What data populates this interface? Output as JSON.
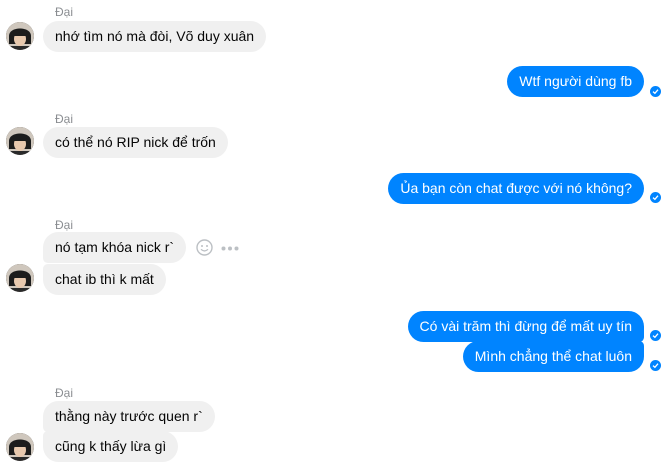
{
  "colors": {
    "outgoing_bubble": "#0084ff",
    "incoming_bubble": "#f0f0f0",
    "sender_name": "#8a8d91",
    "incoming_text": "#050505"
  },
  "messages": [
    {
      "sender": "Đại",
      "text": "nhớ tìm nó mà đòi, Võ duy xuân"
    },
    {
      "text": "Wtf người dùng fb"
    },
    {
      "sender": "Đại",
      "text": "có thể nó RIP nick để trốn"
    },
    {
      "text": "Ủa bạn còn chat được với nó không?"
    },
    {
      "sender": "Đại",
      "text": "nó tạm khóa nick r`"
    },
    {
      "text": "chat ib thì k mất"
    },
    {
      "text": "Có vài trăm thì đừng để mất uy tín"
    },
    {
      "text": "Mình chẳng thể chat luôn"
    },
    {
      "sender": "Đại",
      "text": "thằng này trước quen r`"
    },
    {
      "text": "cũng k thấy lừa gì"
    }
  ],
  "icons": {
    "read_receipt": "check-circle-icon",
    "react": "smiley-icon",
    "more": "more-options-icon"
  }
}
